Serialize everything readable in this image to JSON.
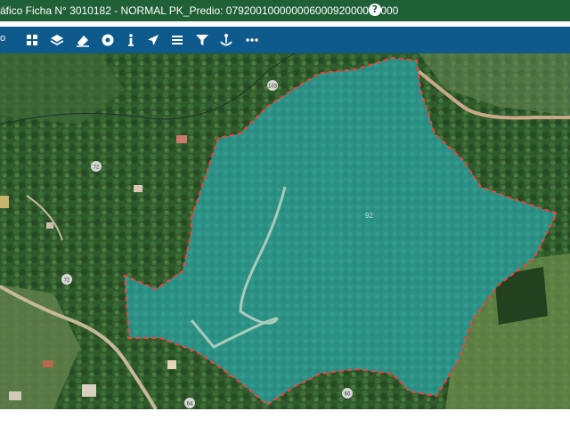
{
  "app": {
    "title": "áfico Ficha N° 3010182 - NORMAL PK_Predio: 07920010000000600092000000000",
    "help_label": "?"
  },
  "toolbar": {
    "left_text": "o",
    "tools": [
      {
        "name": "grid-icon"
      },
      {
        "name": "layers-icon"
      },
      {
        "name": "eraser-icon"
      },
      {
        "name": "record-icon"
      },
      {
        "name": "info-icon"
      },
      {
        "name": "navigate-icon"
      },
      {
        "name": "menu-icon"
      },
      {
        "name": "filter-icon"
      },
      {
        "name": "anchor-icon"
      },
      {
        "name": "more-icon"
      }
    ]
  },
  "map": {
    "parcel_label": "92",
    "road_markers": [
      "103",
      "72",
      "72",
      "64",
      "60"
    ],
    "parcel_fill": "#2fa69a",
    "parcel_outline": "#ff3b3b"
  },
  "colors": {
    "titlebar": "#206036",
    "toolbar": "#0f5a8c"
  }
}
